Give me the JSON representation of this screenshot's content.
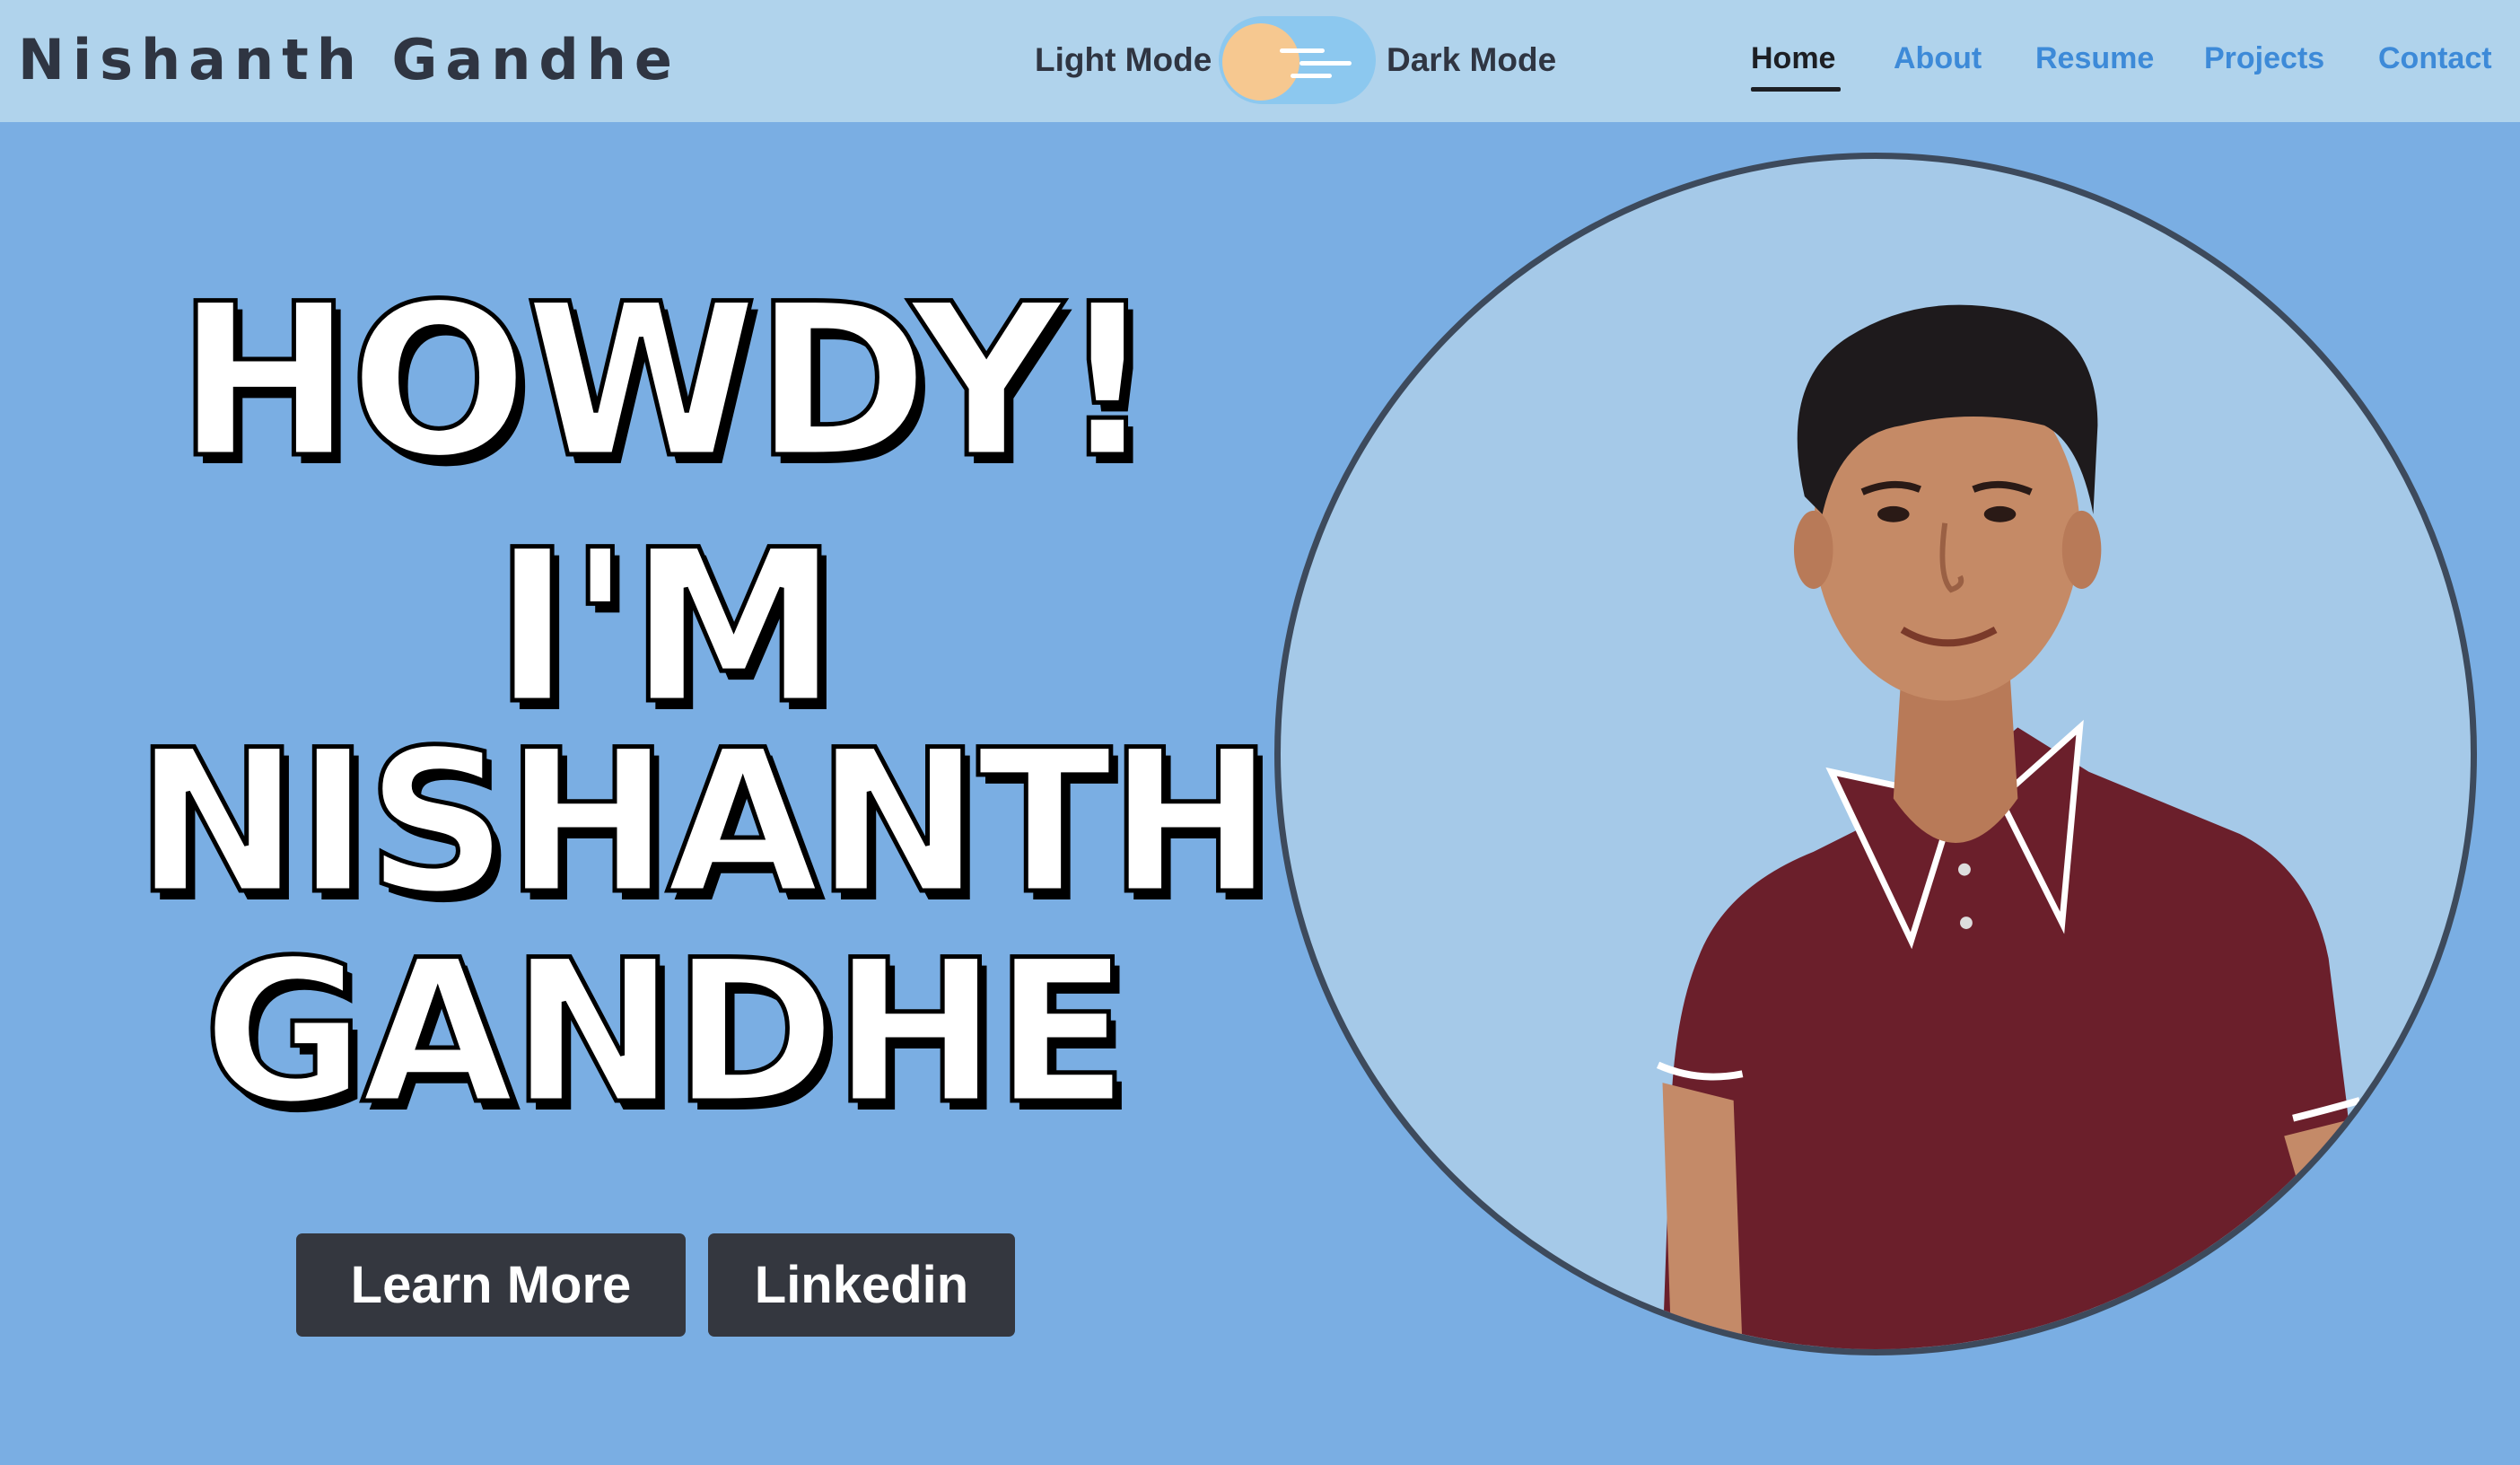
{
  "header": {
    "brand": "Nishanth Gandhe",
    "light_mode_label": "Light Mode",
    "dark_mode_label": "Dark Mode",
    "nav": [
      {
        "label": "Home",
        "active": true
      },
      {
        "label": "About",
        "active": false
      },
      {
        "label": "Resume",
        "active": false
      },
      {
        "label": "Projects",
        "active": false
      },
      {
        "label": "Contact",
        "active": false
      }
    ]
  },
  "hero": {
    "line1": "HOWDY!",
    "line2": "I'M",
    "line3": "NISHANTH",
    "line4": "GANDHE",
    "buttons": {
      "learn_more": "Learn More",
      "linkedin": "Linkedin"
    }
  },
  "colors": {
    "page_background": "#7aaee3",
    "header_background": "#b0d3ec",
    "nav_link": "#3d8ad8",
    "nav_active": "#1d1f24",
    "button_background": "#34373f",
    "toggle_track": "#8cc8ef",
    "toggle_knob": "#f6c890",
    "portrait_background": "#a5c9e8",
    "portrait_border": "#3d4a5c"
  },
  "icons": {
    "theme_toggle": "sun-toggle-icon",
    "portrait": "profile-photo"
  }
}
